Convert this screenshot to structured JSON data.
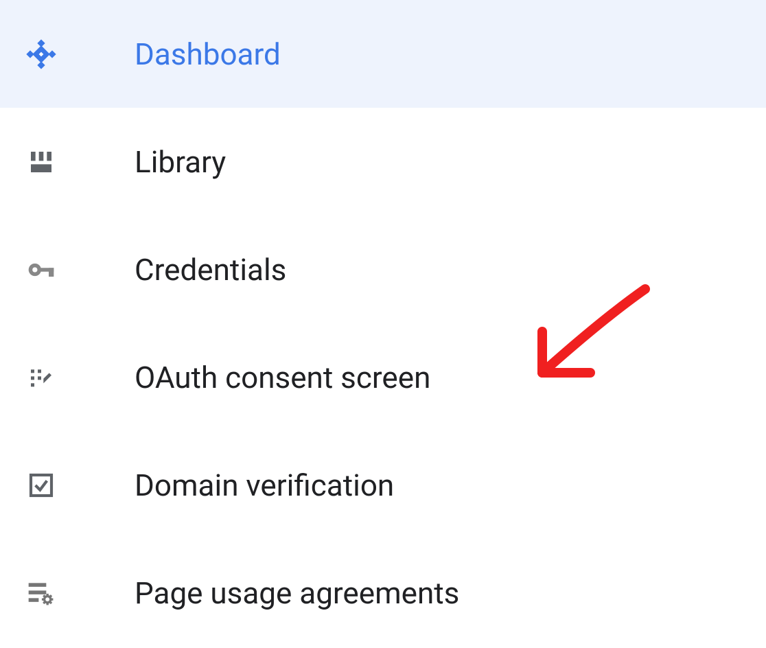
{
  "nav": {
    "items": [
      {
        "label": "Dashboard",
        "icon": "dashboard-icon",
        "active": true
      },
      {
        "label": "Library",
        "icon": "library-icon",
        "active": false
      },
      {
        "label": "Credentials",
        "icon": "key-icon",
        "active": false
      },
      {
        "label": "OAuth consent screen",
        "icon": "consent-icon",
        "active": false
      },
      {
        "label": "Domain verification",
        "icon": "check-square-icon",
        "active": false
      },
      {
        "label": "Page usage agreements",
        "icon": "list-gear-icon",
        "active": false
      }
    ]
  },
  "annotation": {
    "type": "arrow",
    "color": "#f02020",
    "target_item_index": 3
  }
}
